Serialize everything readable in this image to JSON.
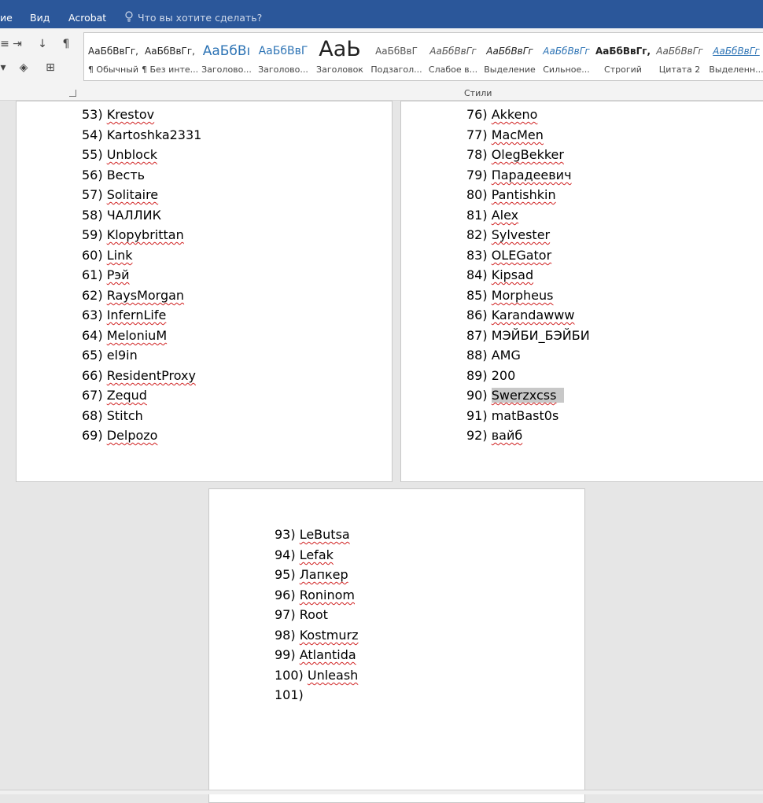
{
  "topbar": {
    "tabs": [
      "ие",
      "Вид",
      "Acrobat"
    ],
    "tell_me": "Что вы хотите сделать?"
  },
  "ribbon": {
    "group_label": "Стили",
    "styles": [
      {
        "sample": "АаБбВвГг,",
        "name": "¶ Обычный"
      },
      {
        "sample": "АаБбВвГг,",
        "name": "¶ Без инте..."
      },
      {
        "sample": "АаБбВı",
        "name": "Заголово..."
      },
      {
        "sample": "АаБбВвГ",
        "name": "Заголово..."
      },
      {
        "sample": "АаЬ",
        "name": "Заголовок"
      },
      {
        "sample": "АаБбВвГ",
        "name": "Подзагол..."
      },
      {
        "sample": "АаБбВвГг",
        "name": "Слабое в..."
      },
      {
        "sample": "АаБбВвГг",
        "name": "Выделение"
      },
      {
        "sample": "АаБбВвГг",
        "name": "Сильное..."
      },
      {
        "sample": "АаБбВвГг,",
        "name": "Строгий"
      },
      {
        "sample": "АаБбВвГг",
        "name": "Цитата 2"
      },
      {
        "sample": "АаБбВвГг",
        "name": "Выделенн..."
      }
    ]
  },
  "page1": {
    "items": [
      {
        "num": "53)",
        "text": "Krestov"
      },
      {
        "num": "54)",
        "text": "Kartoshka2331"
      },
      {
        "num": "55)",
        "text": "Unblock"
      },
      {
        "num": "56)",
        "text": "Весть"
      },
      {
        "num": "57)",
        "text": "Solitaire"
      },
      {
        "num": "58)",
        "text": "ЧАЛЛИК"
      },
      {
        "num": "59)",
        "text": "Klopybrittan"
      },
      {
        "num": "60)",
        "text": "Link"
      },
      {
        "num": "61)",
        "text": "Рэй"
      },
      {
        "num": "62)",
        "text": "RaysMorgan"
      },
      {
        "num": "63)",
        "text": "InfernLife"
      },
      {
        "num": "64)",
        "text": "MeloniuM"
      },
      {
        "num": "65)",
        "text": "el9in"
      },
      {
        "num": "66)",
        "text": "ResidentProxy"
      },
      {
        "num": "67)",
        "text": "Zequd"
      },
      {
        "num": "68)",
        "text": "Stitch"
      },
      {
        "num": "69)",
        "text": "Delpozo"
      }
    ]
  },
  "page2": {
    "items": [
      {
        "num": "76)",
        "text": "Akkeno"
      },
      {
        "num": "77)",
        "text": "MacMen"
      },
      {
        "num": "78)",
        "text": "OlegBekker"
      },
      {
        "num": "79)",
        "text": "Парадеевич"
      },
      {
        "num": "80)",
        "text": "Pantishkin"
      },
      {
        "num": "81)",
        "text": "Alex"
      },
      {
        "num": "82)",
        "text": "Sylvester"
      },
      {
        "num": "83)",
        "text": "OLEGator"
      },
      {
        "num": "84)",
        "text": "Kipsad"
      },
      {
        "num": "85)",
        "text": "Morpheus"
      },
      {
        "num": "86)",
        "text": "Karandawww"
      },
      {
        "num": "87)",
        "text": "МЭЙБИ_БЭЙБИ"
      },
      {
        "num": "88)",
        "text": "AMG"
      },
      {
        "num": "89)",
        "text": "200"
      },
      {
        "num": "90)",
        "text": "Swerzxcss"
      },
      {
        "num": "91)",
        "text": "matBast0s"
      },
      {
        "num": "92)",
        "text": "вайб"
      }
    ]
  },
  "page3": {
    "items": [
      {
        "num": "93)",
        "text": "LeButsa"
      },
      {
        "num": "94)",
        "text": "Lefak"
      },
      {
        "num": "95)",
        "text": "Лапкер"
      },
      {
        "num": "96)",
        "text": "Roninom"
      },
      {
        "num": "97)",
        "text": "Root"
      },
      {
        "num": "98)",
        "text": "Kostmurz"
      },
      {
        "num": "99)",
        "text": "Atlantida"
      },
      {
        "num": "100)",
        "text": " Unleash"
      },
      {
        "num": "101)",
        "text": ""
      }
    ]
  },
  "colors": {
    "titlebar": "#2b579a",
    "spellcheck": "#d02020",
    "selection": "#c8c8c8"
  }
}
